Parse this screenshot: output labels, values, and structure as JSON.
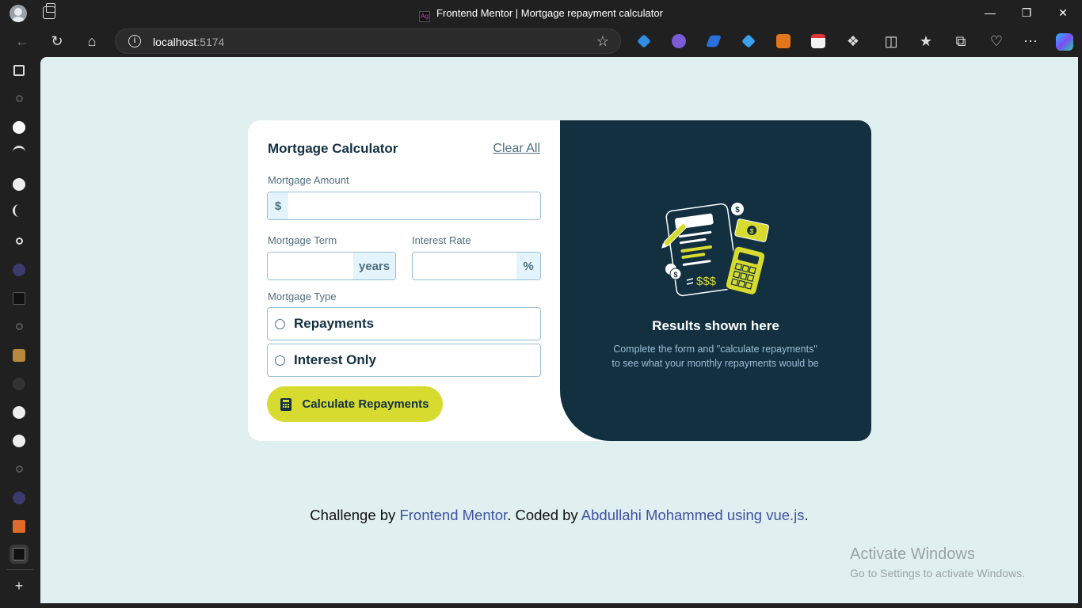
{
  "browser": {
    "tab_title": "Frontend Mentor | Mortgage repayment calculator",
    "url_host": "localhost",
    "url_port": ":5174"
  },
  "form": {
    "title": "Mortgage Calculator",
    "clear_all": "Clear All",
    "amount_label": "Mortgage Amount",
    "amount_prefix": "$",
    "amount_value": "",
    "term_label": "Mortgage Term",
    "term_suffix": "years",
    "term_value": "",
    "rate_label": "Interest Rate",
    "rate_suffix": "%",
    "rate_value": "",
    "type_label": "Mortgage Type",
    "type_options": [
      "Repayments",
      "Interest Only"
    ],
    "submit_label": "Calculate Repayments"
  },
  "results": {
    "title": "Results shown here",
    "desc_line1": "Complete the form and \"calculate repayments\"",
    "desc_line2": "to see what your monthly repayments would be"
  },
  "footer": {
    "prefix": "Challenge by ",
    "link1": "Frontend Mentor",
    "middle": ". Coded by ",
    "link2": "Abdullahi Mohammed using vue.js",
    "suffix": "."
  },
  "watermark": {
    "line1": "Activate Windows",
    "line2": "Go to Settings to activate Windows."
  },
  "colors": {
    "slate_900": "#133041",
    "lime": "#d8db2f",
    "page_bg": "#e0efef",
    "link": "#3e52a3"
  }
}
